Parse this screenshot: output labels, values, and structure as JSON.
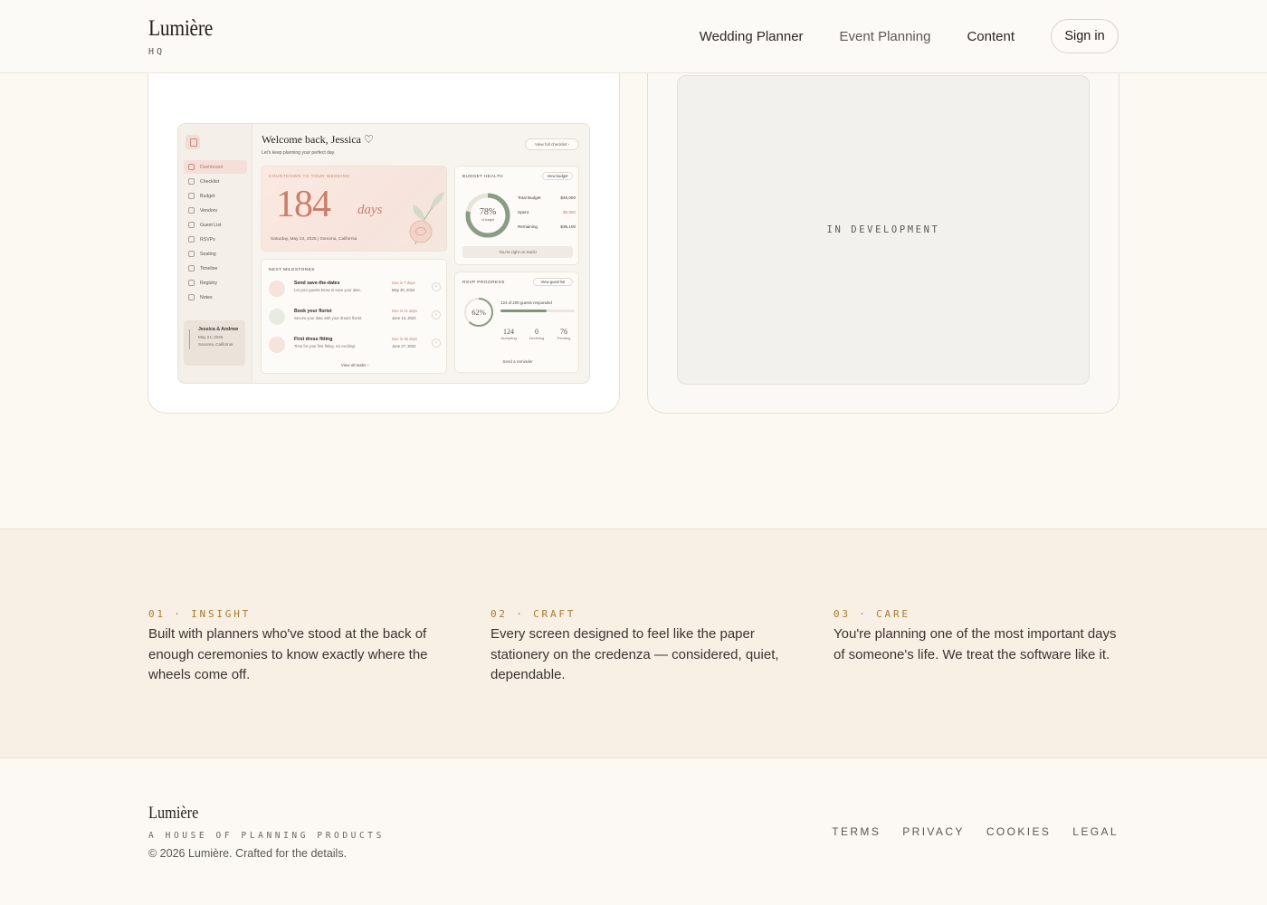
{
  "header": {
    "brand_name": "Lumière",
    "brand_sub": "HQ",
    "nav": [
      "Wedding Planner",
      "Event Planning",
      "Content"
    ],
    "sign_in": "Sign in"
  },
  "preview": {
    "title": "Welcome back, Jessica ♡",
    "subtitle": "Let's keep planning your perfect day.",
    "checklist_button": "View full checklist  ›",
    "sidebar": [
      "Dashboard",
      "Checklist",
      "Budget",
      "Vendors",
      "Guest List",
      "RSVPs",
      "Seating",
      "Timeline",
      "Registry",
      "Notes"
    ],
    "couple": {
      "names": "Jessica & Andrew",
      "date": "May 24, 2025",
      "place": "Sonoma, California"
    },
    "countdown": {
      "label": "COUNTDOWN TO YOUR WEDDING",
      "number": "184",
      "unit": "days",
      "date": "Saturday, May 24, 2025",
      "place": "Sonoma, California"
    },
    "budget": {
      "label": "BUDGET HEALTH",
      "button": "View budget",
      "percent": "78%",
      "percent_note": "of budget remaining",
      "percent_value": 0.78,
      "rows": [
        {
          "label": "Total Budget",
          "value": "$45,000"
        },
        {
          "label": "Spent",
          "value": "$9,900"
        },
        {
          "label": "Remaining",
          "value": "$35,100"
        }
      ],
      "status": "You're right on track!"
    },
    "milestones": {
      "label": "NEXT MILESTONES",
      "items": [
        {
          "title": "Send save-the-dates",
          "desc": "Let your guests know to save your date.",
          "due": "Due in 7 days",
          "date": "May 30, 2024"
        },
        {
          "title": "Book your florist",
          "desc": "Secure your date with your dream florist.",
          "due": "Due in 21 days",
          "date": "June 13, 2024"
        },
        {
          "title": "First dress fitting",
          "desc": "Time for your first fitting. So exciting!",
          "due": "Due in 35 days",
          "date": "June 27, 2024"
        }
      ],
      "footer": "View all tasks  ›"
    },
    "rsvp": {
      "label": "RSVP PROGRESS",
      "button": "View guest list",
      "percent": "62%",
      "percent_value": 0.62,
      "responded": "124 of 200 guests responded",
      "stats": [
        {
          "num": "124",
          "label": "Accepting"
        },
        {
          "num": "0",
          "label": "Declining"
        },
        {
          "num": "76",
          "label": "Pending"
        }
      ],
      "send": "Send a reminder"
    }
  },
  "in_development": "IN DEVELOPMENT",
  "features": [
    {
      "eyebrow": "01 · INSIGHT",
      "body": "Built with planners who've stood at the back of enough ceremonies to know exactly where the wheels come off."
    },
    {
      "eyebrow": "02 · CRAFT",
      "body": "Every screen designed to feel like the paper stationery on the credenza — considered, quiet, dependable."
    },
    {
      "eyebrow": "03 · CARE",
      "body": "You're planning one of the most important days of someone's life. We treat the software like it."
    }
  ],
  "footer": {
    "brand": "Lumière",
    "tagline": "A HOUSE OF PLANNING PRODUCTS",
    "copyright": "© 2026 Lumière. Crafted for the details.",
    "links": [
      "TERMS",
      "PRIVACY",
      "COOKIES",
      "LEGAL"
    ]
  },
  "colors": {
    "accent_gold": "#a67b33",
    "rose": "#c97f6c",
    "sage": "#7f9580",
    "page_bg": "#fcf8f2"
  }
}
